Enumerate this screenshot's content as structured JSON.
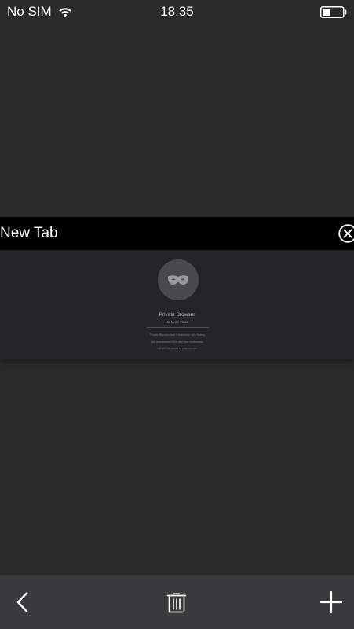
{
  "status_bar": {
    "carrier": "No SIM",
    "time": "18:35",
    "icons": [
      "wifi-icon",
      "battery-icon"
    ]
  },
  "tab": {
    "title": "New Tab",
    "close_icon": "close-circle-icon",
    "preview": {
      "icon": "mask-icon",
      "title": "Private Browser",
      "subtitle": "No More Trace",
      "description_lines": [
        "Private Browser won't remember any history,",
        "but downloaded files and new bookmarks",
        "will still be saved to your device."
      ]
    }
  },
  "toolbar": {
    "back_icon": "chevron-left-icon",
    "trash_icon": "trash-icon",
    "add_icon": "plus-icon"
  },
  "colors": {
    "background": "#2a2a2a",
    "tab_header": "#000000",
    "preview_background": "#232328",
    "toolbar": "#3a3a3c",
    "foreground": "#ffffff"
  }
}
